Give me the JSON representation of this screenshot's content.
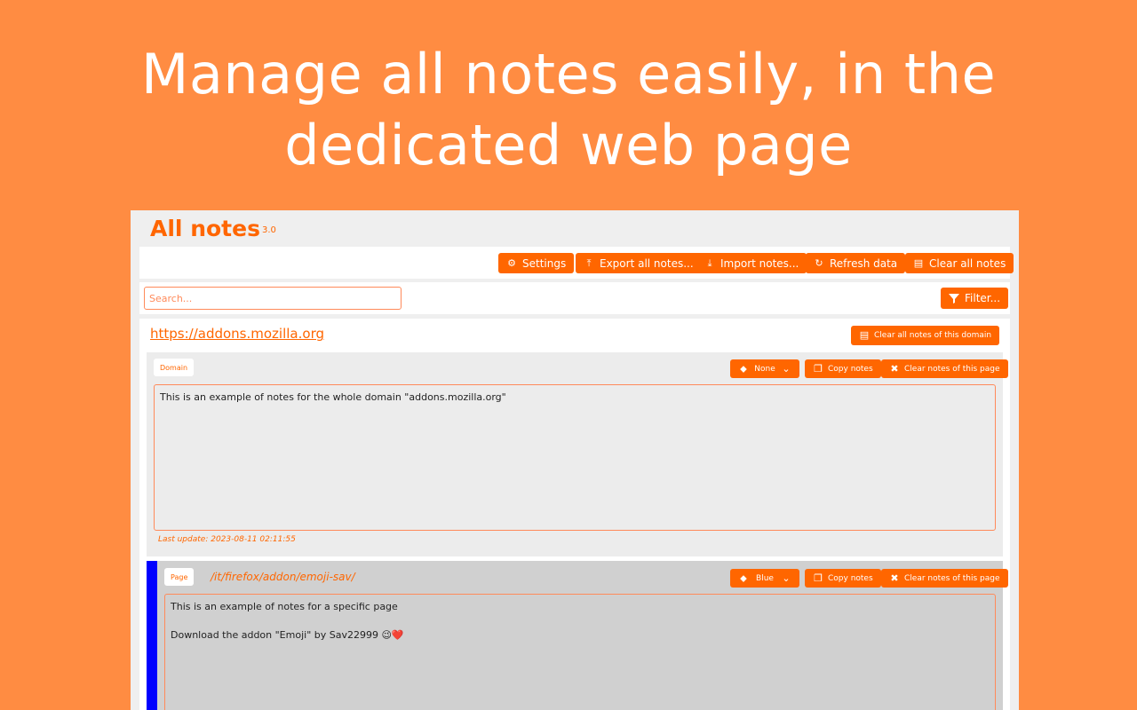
{
  "headline": {
    "line1": "Manage all notes easily, in the",
    "line2": "dedicated web page"
  },
  "app": {
    "title": "All notes",
    "version": "3.0",
    "toolbar": {
      "settings": "Settings",
      "export": "Export all notes...",
      "import": "Import notes...",
      "refresh": "Refresh data",
      "clear_all": "Clear all notes"
    },
    "search": {
      "placeholder": "Search...",
      "filter": "Filter..."
    },
    "domain": {
      "url": "https://addons.mozilla.org",
      "clear_domain": "Clear all notes of this domain"
    },
    "notes": [
      {
        "tag": "Domain",
        "color": "None",
        "copy": "Copy notes",
        "clear": "Clear notes of this page",
        "text": "This is an example of notes for the whole domain \"addons.mozilla.org\"",
        "last_update": "Last update: 2023-08-11 02:11:55"
      },
      {
        "tag": "Page",
        "path": "/it/firefox/addon/emoji-sav/",
        "color": "Blue",
        "color_hex": "#0000ff",
        "copy": "Copy notes",
        "clear": "Clear notes of this page",
        "text_line1": "This is an example of notes for a specific page",
        "text_line2": "Download the addon \"Emoji\" by Sav22999 😉❤️"
      }
    ]
  },
  "colors": {
    "background": "#ff8c42",
    "accent": "#ff6600"
  }
}
